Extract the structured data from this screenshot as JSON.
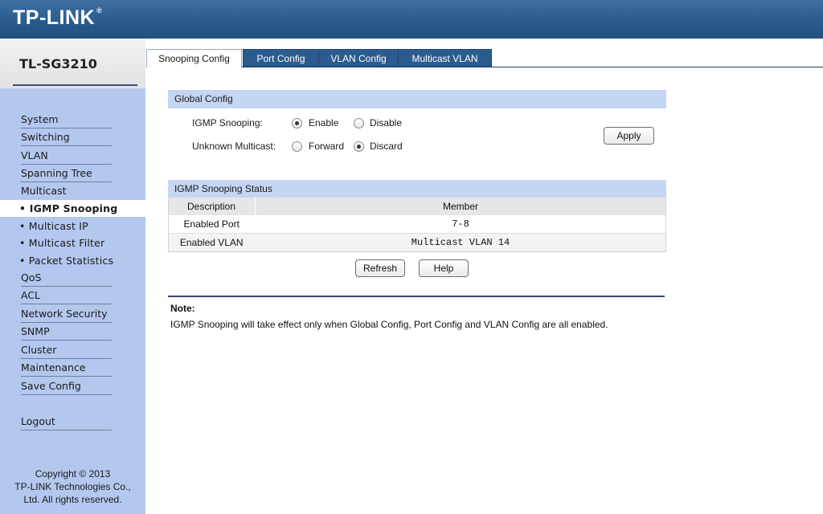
{
  "brand": {
    "logo": "TP-LINK",
    "tm": "®"
  },
  "sidebar": {
    "model": "TL-SG3210",
    "items": [
      {
        "label": "System"
      },
      {
        "label": "Switching"
      },
      {
        "label": "VLAN"
      },
      {
        "label": "Spanning Tree"
      },
      {
        "label": "Multicast"
      }
    ],
    "subitems": [
      {
        "label": "• IGMP Snooping",
        "active": true
      },
      {
        "label": "• Multicast IP"
      },
      {
        "label": "• Multicast Filter"
      },
      {
        "label": "• Packet Statistics"
      }
    ],
    "items_after": [
      {
        "label": "QoS"
      },
      {
        "label": "ACL"
      },
      {
        "label": "Network Security"
      },
      {
        "label": "SNMP"
      },
      {
        "label": "Cluster"
      },
      {
        "label": "Maintenance"
      },
      {
        "label": "Save Config"
      }
    ],
    "logout": "Logout",
    "copyright": [
      "Copyright © 2013",
      "TP-LINK Technologies Co.,",
      "Ltd. All rights reserved."
    ]
  },
  "tabs": [
    {
      "label": "Snooping Config",
      "active": true
    },
    {
      "label": "Port Config"
    },
    {
      "label": "VLAN Config"
    },
    {
      "label": "Multicast VLAN"
    }
  ],
  "global_config": {
    "title": "Global Config",
    "igmp_label": "IGMP Snooping:",
    "igmp_options": [
      "Enable",
      "Disable"
    ],
    "igmp_selected": "Enable",
    "unknown_label": "Unknown Multicast:",
    "unknown_options": [
      "Forward",
      "Discard"
    ],
    "unknown_selected": "Discard",
    "apply_label": "Apply"
  },
  "status": {
    "title": "IGMP Snooping Status",
    "columns": [
      "Description",
      "Member"
    ],
    "rows": [
      {
        "description": "Enabled Port",
        "member": "7-8"
      },
      {
        "description": "Enabled VLAN",
        "member": "Multicast VLAN 14"
      }
    ],
    "refresh_label": "Refresh",
    "help_label": "Help"
  },
  "note": {
    "title": "Note:",
    "text": "IGMP Snooping will take effect only when Global Config, Port Config and VLAN Config are all enabled."
  },
  "colors": {
    "header": "#2a5b8f",
    "sidebar": "#b4c7ee",
    "section_head": "#c5d6f3",
    "tab": "#2b5c8f"
  }
}
